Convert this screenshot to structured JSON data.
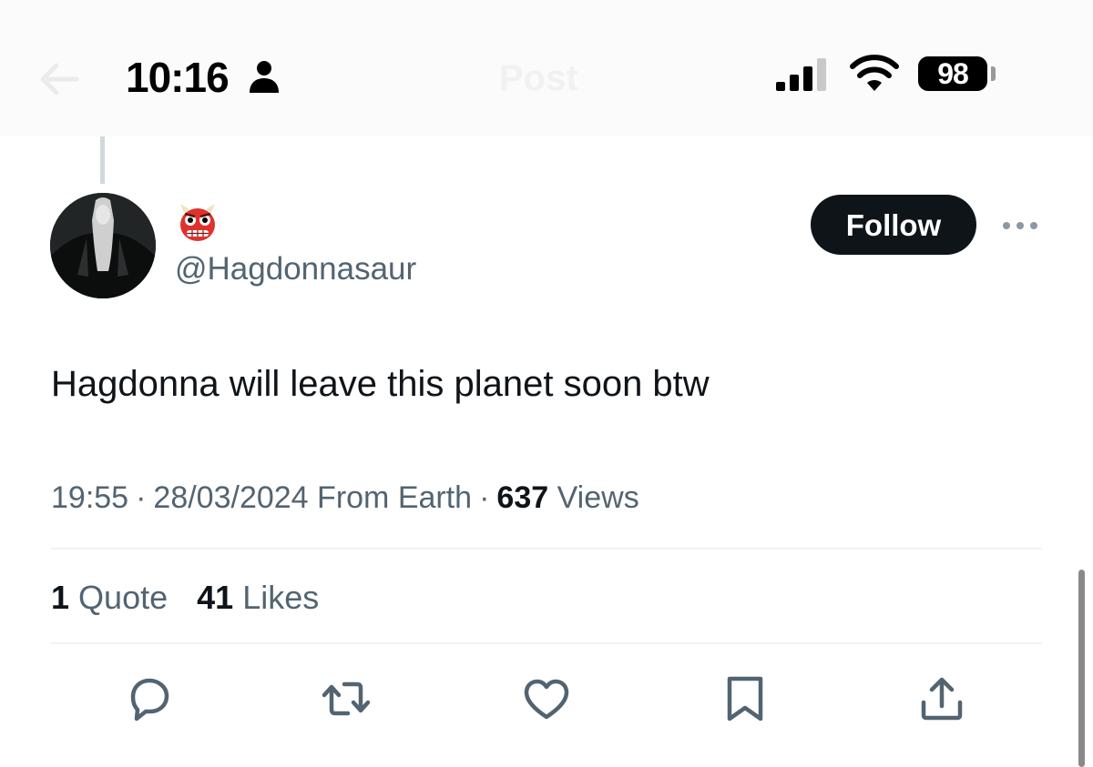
{
  "nav": {
    "title": "Post"
  },
  "status_bar": {
    "time": "10:16",
    "battery": "98"
  },
  "tweet": {
    "display_name_icon": "ogre-emoji-icon",
    "handle": "@Hagdonnasaur",
    "follow_label": "Follow",
    "text": "Hagdonna will leave this planet soon btw",
    "time": "19:55",
    "date": "28/03/2024",
    "location": "From Earth",
    "views_count": "637",
    "views_label": "Views",
    "quotes_count": "1",
    "quotes_label": "Quote",
    "likes_count": "41",
    "likes_label": "Likes"
  },
  "actions": [
    "reply-icon",
    "retweet-icon",
    "like-icon",
    "bookmark-icon",
    "share-icon"
  ],
  "colors": {
    "text_primary": "#0f1419",
    "text_secondary": "#536471",
    "divider": "#eff3f4",
    "follow_bg": "#0f1419",
    "emoji_red": "#e0322d"
  }
}
